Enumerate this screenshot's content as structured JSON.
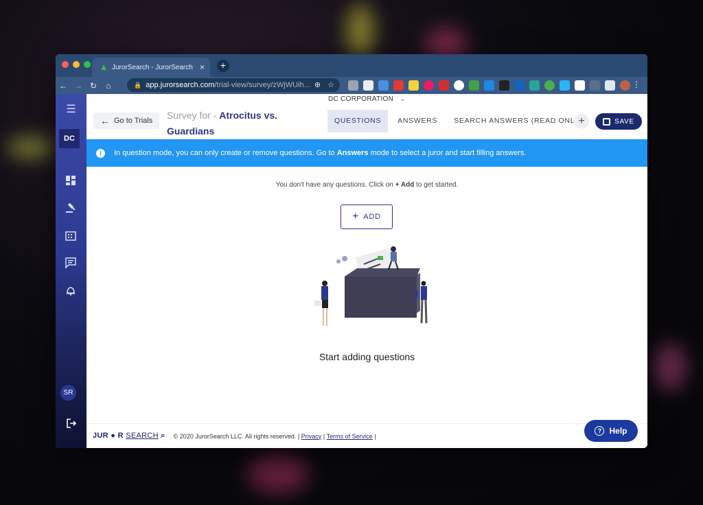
{
  "browser": {
    "tab_title": "JurorSearch - JurorSearch",
    "tab_close": "×",
    "new_tab": "+",
    "url_host": "app.jurorsearch.com",
    "url_path": "/trial-view/survey/zWjWUih...",
    "traffic_colors": [
      "#fe5f57",
      "#febc2e",
      "#28c840"
    ]
  },
  "org_selector": {
    "label": "DC CORPORATION",
    "caret": "⌄"
  },
  "header": {
    "back_label": "Go to Trials",
    "survey_prefix": "Survey for -",
    "survey_name_line1": "Atrocitus vs.",
    "survey_name_line2": "Guardians",
    "tabs": [
      {
        "label": "QUESTIONS"
      },
      {
        "label": "ANSWERS"
      },
      {
        "label": "SEARCH ANSWERS (READ ONLY)"
      }
    ],
    "plus": "+",
    "save_label": "SAVE"
  },
  "sidebar": {
    "workspace_initials": "DC",
    "user_initials": "SR"
  },
  "info_banner": {
    "text_before": "In question mode, you can only create or remove questions. Go to ",
    "bold": "Answers",
    "text_after": " mode to select a juror and start filling answers."
  },
  "content": {
    "empty_before": "You don't have any questions. Click on ",
    "empty_bold": "+ Add",
    "empty_after": " to get started.",
    "add_label": "ADD",
    "start_text": "Start adding questions"
  },
  "footer": {
    "logo_a": "JUR",
    "logo_b": "R",
    "logo_c": "SEARCH",
    "copyright": "© 2020 JurorSearch LLC. All rights reserved. |",
    "privacy": "Privacy",
    "sep": "|",
    "terms": "Terms of Service",
    "sep_end": "|"
  },
  "help_label": "Help",
  "colors": {
    "primary": "#1c2a6e",
    "info": "#2196f3",
    "sidebar": "#3c4aa8"
  }
}
